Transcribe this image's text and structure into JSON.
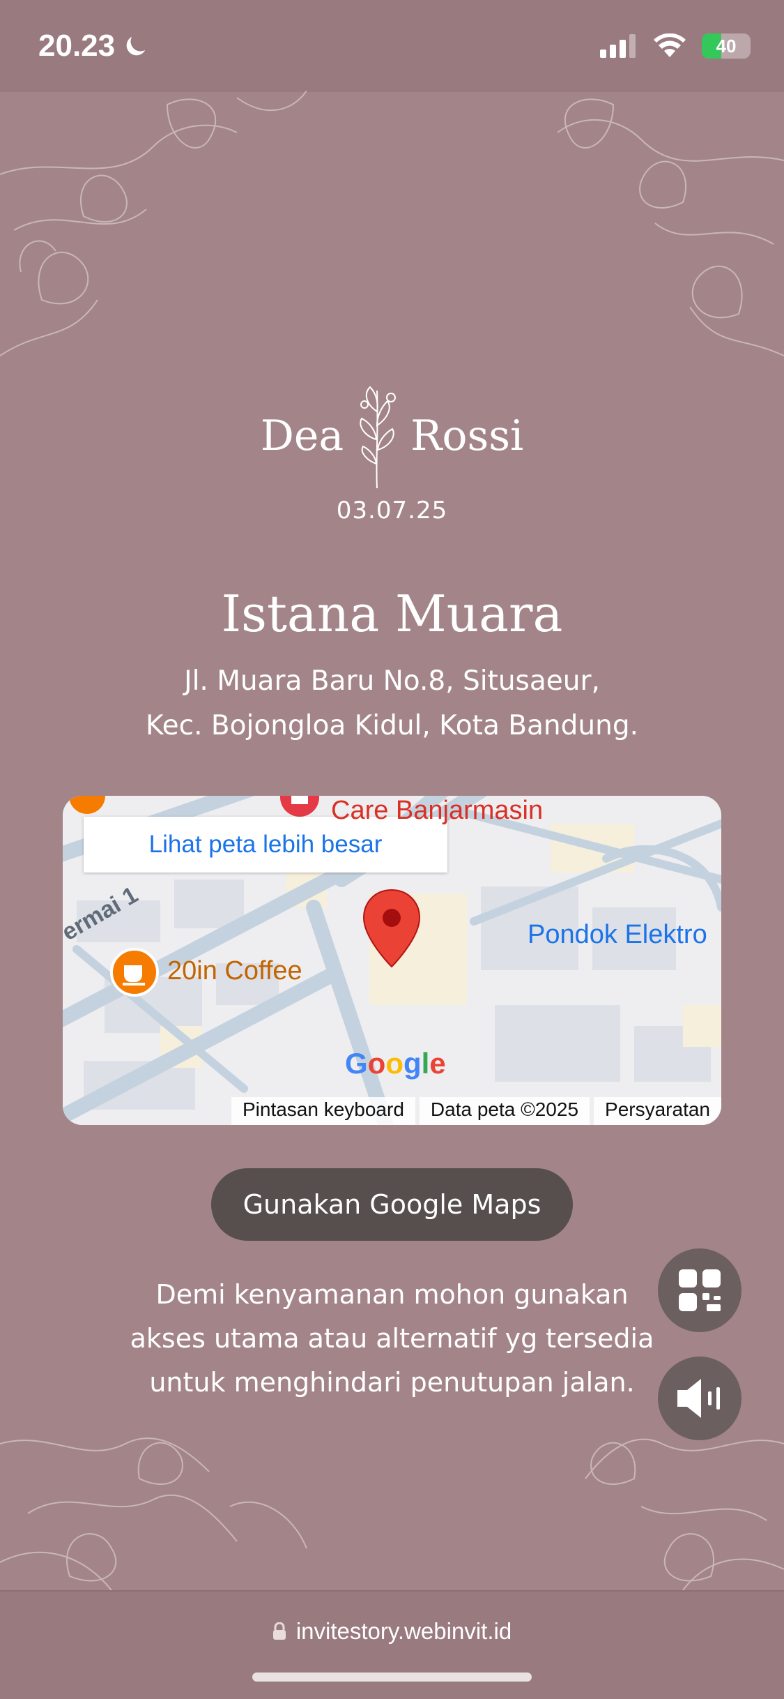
{
  "status_bar": {
    "time": "20.23",
    "battery": "40",
    "battery_level": 0.4
  },
  "invitation": {
    "bride": "Dea",
    "groom": "Rossi",
    "date": "03.07.25",
    "venue": "Istana Muara",
    "address_line1": "Jl. Muara Baru No.8, Situsaeur,",
    "address_line2": "Kec. Bojongloa Kidul, Kota Bandung."
  },
  "map": {
    "larger_map_link": "Lihat peta lebih besar",
    "labels": {
      "coffee": "20in Coffee",
      "pondok": "Pondok Elektro",
      "banjarmasin": "Care Banjarmasin",
      "street": "ermai 1"
    },
    "google": "Google",
    "footer": {
      "shortcuts": "Pintasan keyboard",
      "data": "Data peta ©2025",
      "terms": "Persyaratan"
    }
  },
  "actions": {
    "maps_button": "Gunakan Google Maps"
  },
  "note": {
    "line1": "Demi kenyamanan mohon gunakan",
    "line2": "akses utama atau alternatif yg tersedia",
    "line3": "untuk menghindari penutupan jalan."
  },
  "browser": {
    "url": "invitestory.webinvit.id"
  },
  "colors": {
    "background": "#a38589",
    "button": "#574e4e",
    "fab": "#6b5f60",
    "map_link": "#1a73e8"
  }
}
